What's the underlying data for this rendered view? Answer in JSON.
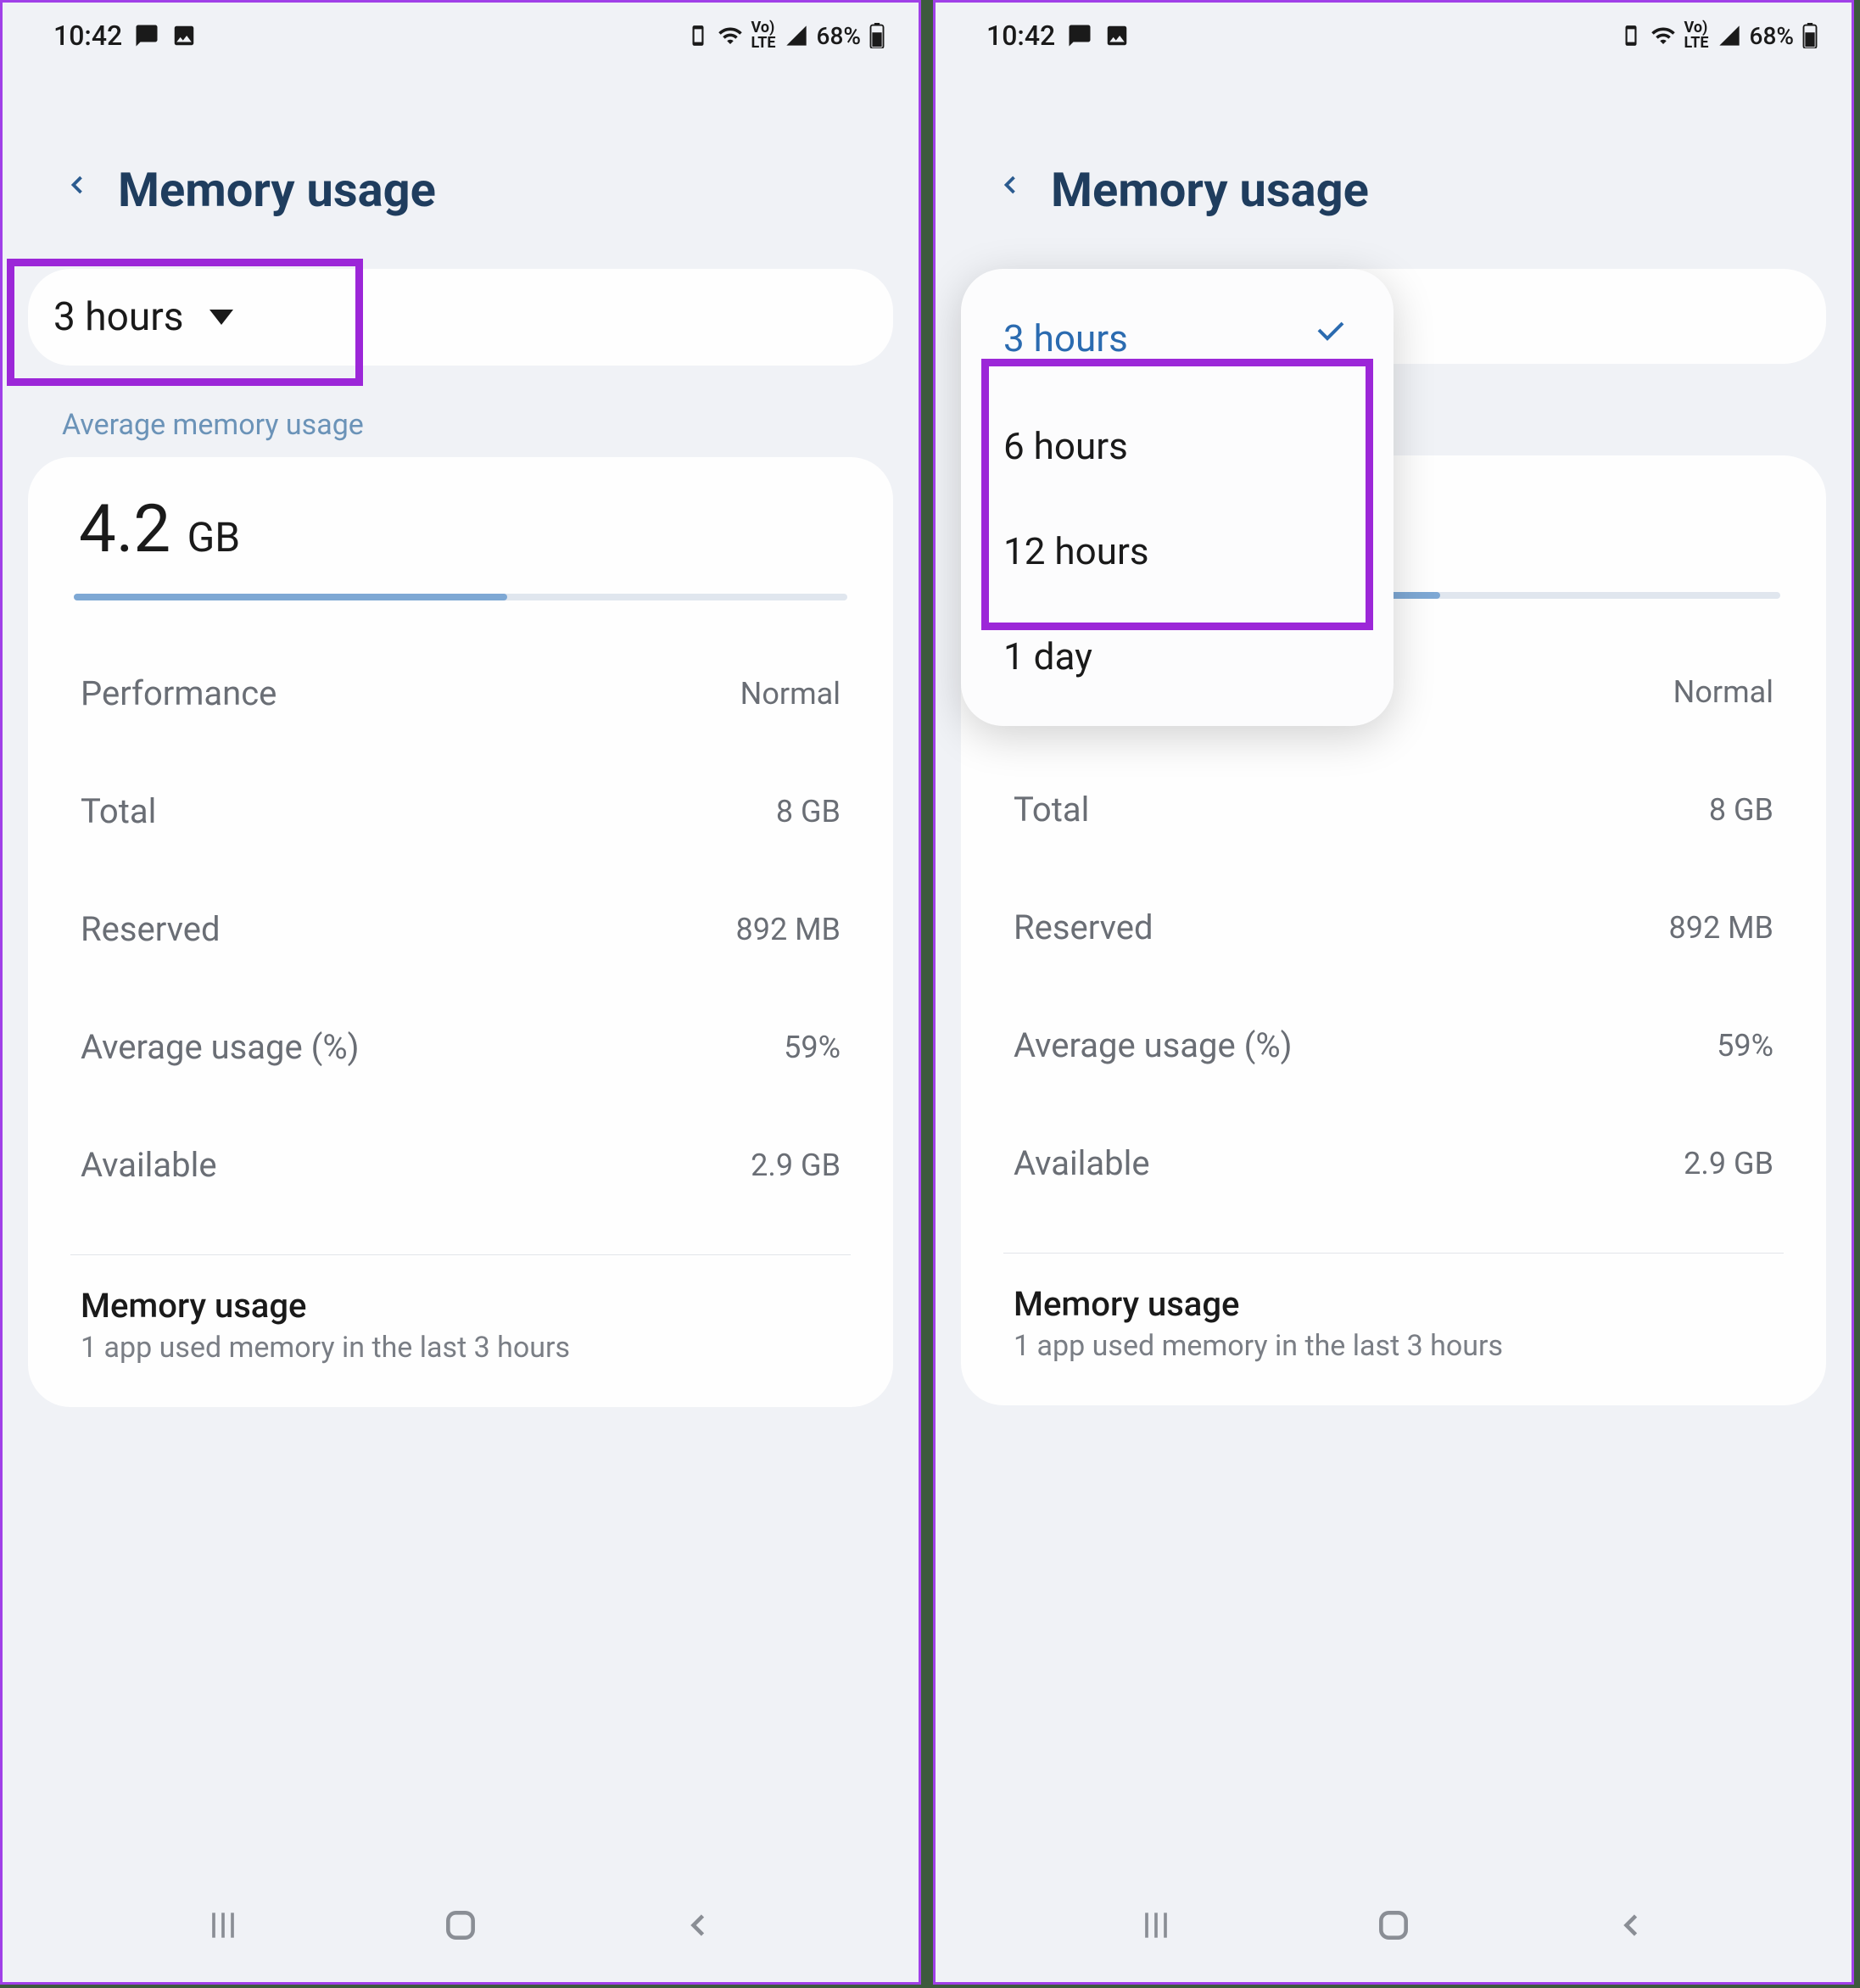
{
  "status": {
    "time": "10:42",
    "battery_pct": "68%"
  },
  "header": {
    "title": "Memory usage"
  },
  "dropdown": {
    "selected": "3 hours",
    "options": [
      "3 hours",
      "6 hours",
      "12 hours",
      "1 day"
    ]
  },
  "avg_section": {
    "label": "Average memory usage",
    "value_num": "4.2",
    "value_unit": "GB",
    "progress_pct": 56
  },
  "rows": {
    "performance": {
      "label": "Performance",
      "value": "Normal"
    },
    "total": {
      "label": "Total",
      "value": "8 GB"
    },
    "reserved": {
      "label": "Reserved",
      "value": "892 MB"
    },
    "avg_pct": {
      "label": "Average usage (%)",
      "value": "59%"
    },
    "available": {
      "label": "Available",
      "value": "2.9 GB"
    }
  },
  "mem_usage": {
    "title": "Memory usage",
    "subtitle": "1 app used memory in the last 3 hours"
  }
}
